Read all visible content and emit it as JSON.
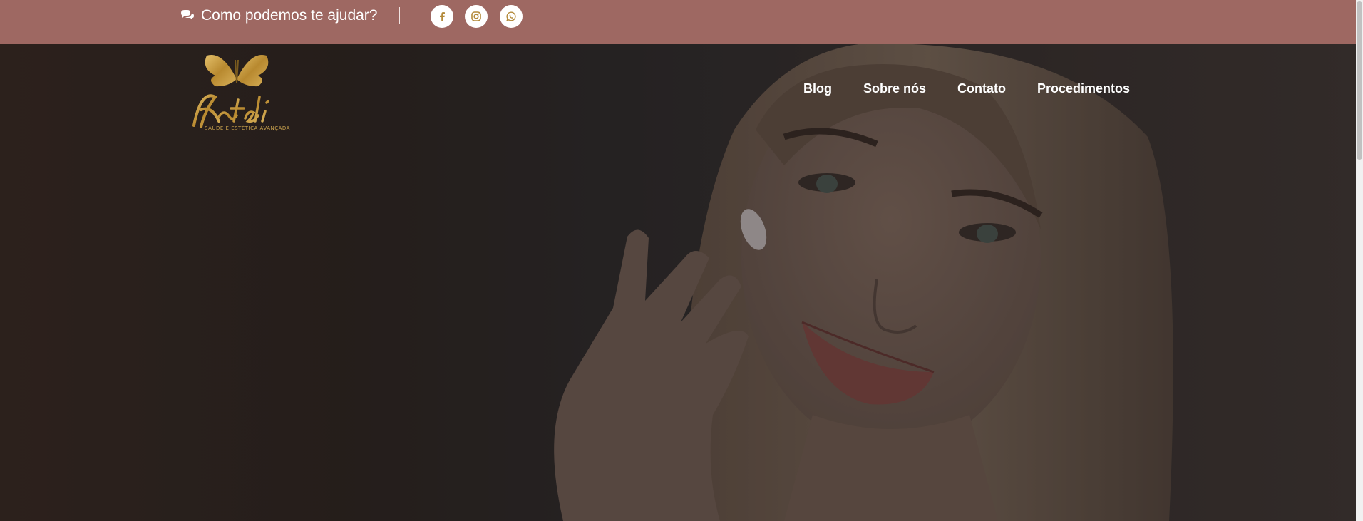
{
  "topbar": {
    "help_text": "Como podemos te ajudar?",
    "icons": [
      "chat-icon",
      "facebook-icon",
      "instagram-icon",
      "whatsapp-icon"
    ],
    "colors": {
      "bar": "#9e6862",
      "icon": "#b38a3a"
    }
  },
  "logo": {
    "name": "Kateli",
    "tagline": "SAÚDE E ESTÉTICA AVANÇADA"
  },
  "nav": {
    "items": [
      "Blog",
      "Sobre nós",
      "Contato",
      "Procedimentos"
    ]
  },
  "hero": {
    "image": "woman-applying-cream"
  }
}
